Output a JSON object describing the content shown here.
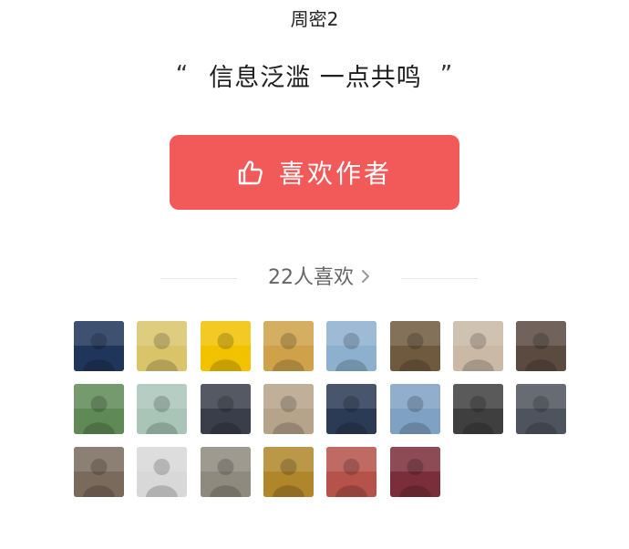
{
  "author": {
    "name": "周密2"
  },
  "quote": {
    "open_mark": "“",
    "text": "信息泛滥 一点共鸣",
    "close_mark": "”"
  },
  "like_button": {
    "label": "喜欢作者",
    "icon": "thumbs-up-icon",
    "color": "#f25a5a"
  },
  "likers": {
    "summary": "22人喜欢",
    "count": 22,
    "avatars": [
      {
        "name": "avatar-book-cover-blue",
        "color": "#20355a"
      },
      {
        "name": "avatar-man-yellow-shirt",
        "color": "#d9c46a"
      },
      {
        "name": "avatar-logo-d",
        "color": "#f2c200"
      },
      {
        "name": "avatar-delight-logo",
        "color": "#cfa148"
      },
      {
        "name": "avatar-beach",
        "color": "#8db0cf"
      },
      {
        "name": "avatar-man-fan",
        "color": "#6f5a3e"
      },
      {
        "name": "avatar-calligraphy-plate",
        "color": "#c9b9a5"
      },
      {
        "name": "avatar-dark-stones",
        "color": "#5a4a40"
      },
      {
        "name": "avatar-green-book",
        "color": "#5f8a55"
      },
      {
        "name": "avatar-blurred",
        "color": "#a9c5b8"
      },
      {
        "name": "avatar-man-suit",
        "color": "#3a3e4a"
      },
      {
        "name": "avatar-woman-poster",
        "color": "#b6a48a"
      },
      {
        "name": "avatar-man-suit-tie",
        "color": "#2b3a55"
      },
      {
        "name": "avatar-coast-cliff",
        "color": "#7fa1c4"
      },
      {
        "name": "avatar-man-black-suit",
        "color": "#3f3f3f"
      },
      {
        "name": "avatar-man-grey-suit",
        "color": "#4e545e"
      },
      {
        "name": "avatar-woman-glasses",
        "color": "#7a6a5c"
      },
      {
        "name": "avatar-man-cap-poster",
        "color": "#d8d8d8"
      },
      {
        "name": "avatar-man-cap-street",
        "color": "#8f8a7e"
      },
      {
        "name": "avatar-golden-plants",
        "color": "#b0862a"
      },
      {
        "name": "avatar-painting-figures",
        "color": "#b5524a"
      },
      {
        "name": "avatar-city-night",
        "color": "#7a2e3a"
      }
    ]
  }
}
